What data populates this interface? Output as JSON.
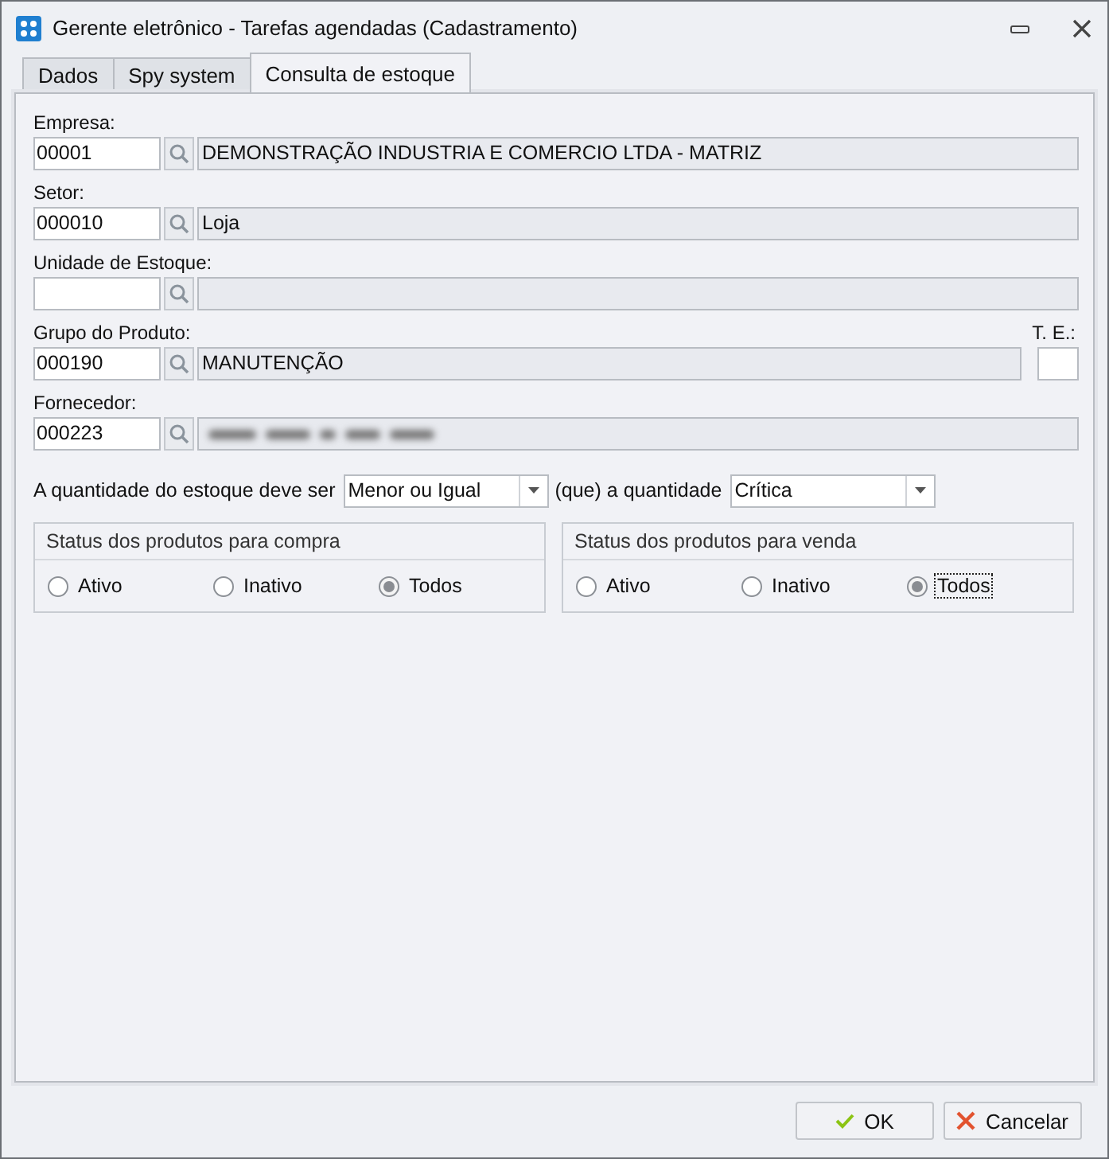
{
  "window": {
    "title": "Gerente eletrônico - Tarefas agendadas (Cadastramento)"
  },
  "tabs": [
    {
      "label": "Dados",
      "selected": false
    },
    {
      "label": "Spy system",
      "selected": false
    },
    {
      "label": "Consulta de estoque",
      "selected": true
    }
  ],
  "fields": [
    {
      "label": "Empresa:",
      "code": "00001",
      "description": "DEMONSTRAÇÃO INDUSTRIA E COMERCIO LTDA - MATRIZ"
    },
    {
      "label": "Setor:",
      "code": "000010",
      "description": "Loja"
    },
    {
      "label": "Unidade de Estoque:"
    },
    {
      "label": "Grupo do Produto:",
      "code": "000190",
      "description": "MANUTENÇÃO",
      "te": {
        "label": "T. E.:"
      }
    },
    {
      "label": "Fornecedor:",
      "code": "000223",
      "redacted": true
    }
  ],
  "quantity_row": [
    {
      "kind": "text",
      "text": "A quantidade do estoque deve ser"
    },
    {
      "kind": "select",
      "value": "Menor ou Igual"
    },
    {
      "kind": "text",
      "text": "(que) a quantidade"
    },
    {
      "kind": "select",
      "value": "Crítica"
    }
  ],
  "status_groups": [
    {
      "title": "Status dos produtos para compra",
      "options": [
        {
          "label": "Ativo",
          "selected": false,
          "focused": false
        },
        {
          "label": "Inativo",
          "selected": false,
          "focused": false
        },
        {
          "label": "Todos",
          "selected": true,
          "focused": false
        }
      ]
    },
    {
      "title": "Status dos produtos para venda",
      "options": [
        {
          "label": "Ativo",
          "selected": false,
          "focused": false
        },
        {
          "label": "Inativo",
          "selected": false,
          "focused": false
        },
        {
          "label": "Todos",
          "selected": true,
          "focused": true
        }
      ]
    }
  ],
  "buttons": [
    {
      "label": "OK",
      "kind": "ok"
    },
    {
      "label": "Cancelar",
      "kind": "cancel"
    }
  ]
}
